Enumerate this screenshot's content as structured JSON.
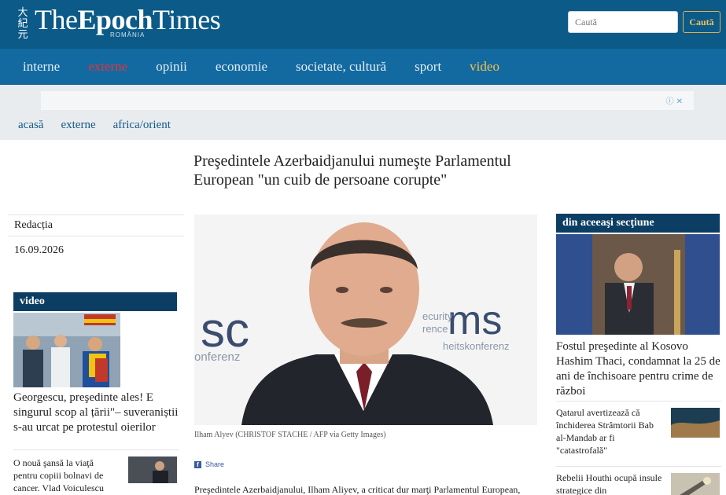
{
  "header": {
    "brand_emblem": "大紀元",
    "brand_the": "The",
    "brand_epoch": "Epoch",
    "brand_times": "Times",
    "brand_sub": "ROMÂNIA",
    "search_placeholder": "Caută",
    "search_button": "Caută"
  },
  "nav": [
    "interne",
    "externe",
    "opinii",
    "economie",
    "societate, cultură",
    "sport",
    "video"
  ],
  "ad": {
    "icon": "ⓘ ✕"
  },
  "breadcrumb": [
    "acasă",
    "externe",
    "africa/orient"
  ],
  "article": {
    "title": "Preşedintele Azerbaidjanului numeşte Parlamentul European \"un cuib de persoane corupte\"",
    "author": "Redacția",
    "date": "16.09.2026",
    "caption": "Ilham Alyev (CHRISTOF STACHE / AFP via Getty Images)",
    "share": "Share",
    "lead": "Preşedintele Azerbaidjanului, Ilham Aliyev, a criticat dur marţi Parlamentul European,",
    "image_backdrop_1": "sc",
    "image_backdrop_2": "ms",
    "image_backdrop_small_1": "onferenz",
    "image_backdrop_small_2": "ecurity",
    "image_backdrop_small_3": "rence",
    "image_backdrop_small_4": "heitskonferenz"
  },
  "left": {
    "video_heading": "video",
    "video_title": "Georgescu, preşedinte ales! E singurul scop al țării\"– suveraniștii s-au urcat pe protestul oierilor",
    "item1": "O nouă şansă la viaţă pentru copiii bolnavi de cancer. Vlad Voiculescu"
  },
  "right": {
    "heading": "din aceeaşi secţiune",
    "main_title": "Fostul preşedinte al Kosovo Hashim Thaci, condamnat la 25 de ani de închisoare pentru crime de război",
    "items": [
      "Qatarul avertizează că închiderea Strâmtorii Bab al-Mandab ar fi \"catastrofală\"",
      "Rebelii Houthi ocupă insule strategice din"
    ]
  },
  "colors": {
    "header_bg": "#0b5a88",
    "nav_bg": "#136aa0",
    "accent_red": "#e8323c",
    "accent_gold": "#f2c14f",
    "section_head": "#0c3e63"
  }
}
